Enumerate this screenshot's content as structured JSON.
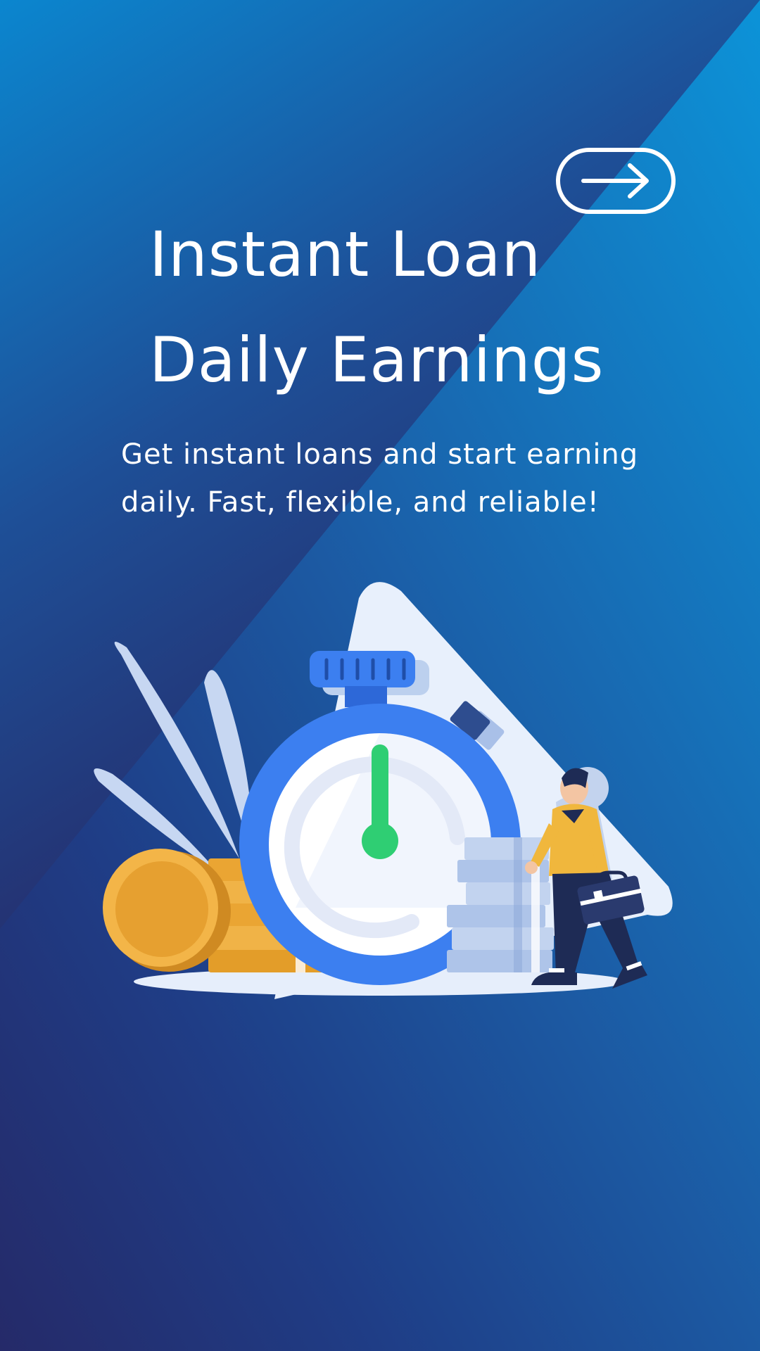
{
  "hero": {
    "title_line_1": "Instant Loan",
    "title_line_2": "Daily Earnings",
    "subtitle": "Get instant loans and start earning daily. Fast, flexible, and reliable!"
  },
  "actions": {
    "next_icon": "arrow-right-icon"
  },
  "illustration": {
    "icons": [
      "stopwatch-icon",
      "coin-stack-icon",
      "gold-coin-icon",
      "banknote-stack-icon",
      "businessman-figure",
      "briefcase-icon",
      "leaf-icon"
    ]
  },
  "colors": {
    "background_top": "#1381c9",
    "background_dark": "#262a68",
    "accent_blue": "#3c7ff0",
    "accent_green": "#2fce73",
    "coin_gold": "#e8a12c",
    "text": "#ffffff"
  }
}
